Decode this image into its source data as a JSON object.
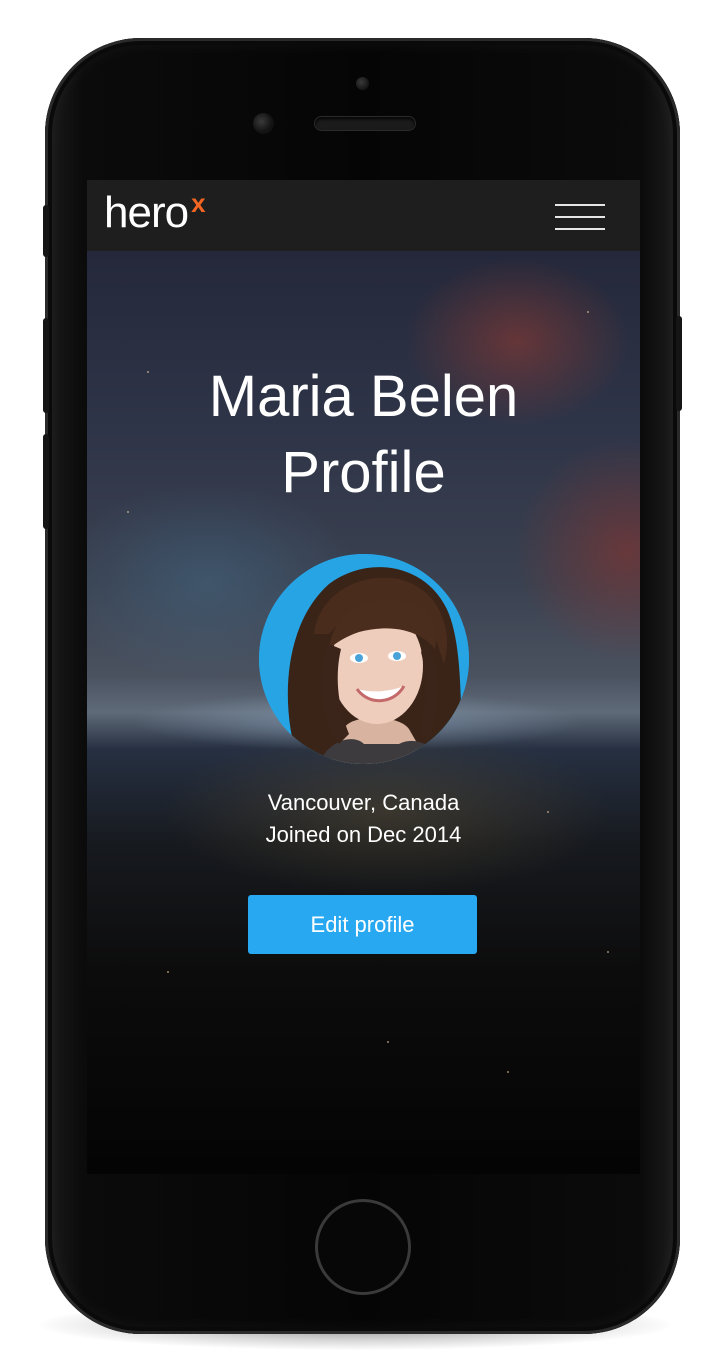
{
  "app": {
    "logo_text": "hero",
    "logo_mark": "x",
    "menu_icon": "hamburger-menu-icon"
  },
  "profile": {
    "title_line1": "Maria Belen",
    "title_line2": "Profile",
    "location": "Vancouver, Canada",
    "joined": "Joined on Dec 2014",
    "edit_label": "Edit profile",
    "avatar_icon": "user-photo"
  },
  "colors": {
    "brand_orange": "#f26522",
    "button_blue": "#29a8f2",
    "navbar_bg": "#1e1e1e",
    "avatar_bg": "#27a4e4"
  }
}
